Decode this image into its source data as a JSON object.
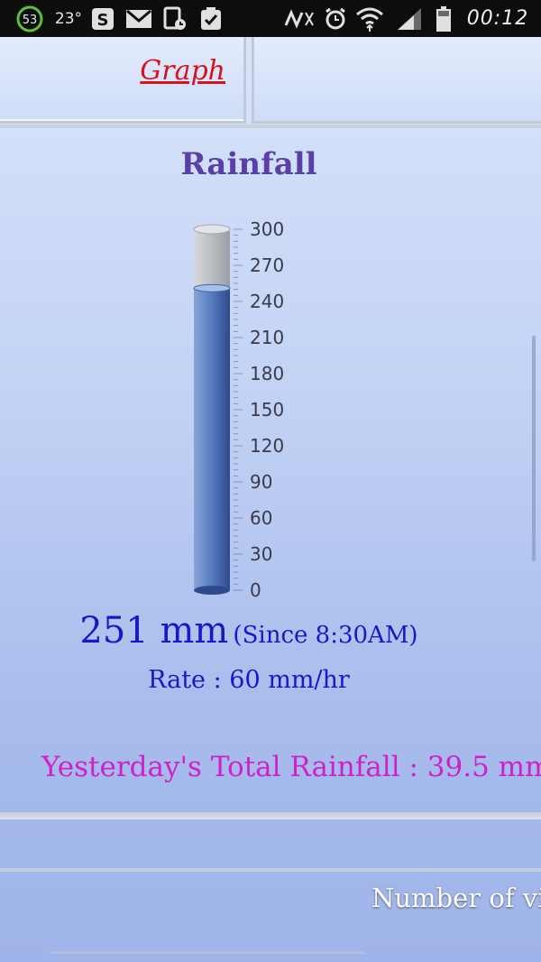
{
  "status_bar": {
    "notification_count": "53",
    "temperature": "23°",
    "time": "00:12",
    "icons": [
      "battery-saver-icon",
      "skype-icon",
      "gmail-icon",
      "calendar-icon",
      "task-icon",
      "nfc-icon",
      "alarm-icon",
      "wifi-icon",
      "signal-icon",
      "battery-icon"
    ]
  },
  "header": {
    "graph_link": "Graph"
  },
  "gauge": {
    "title": "Rainfall",
    "value": 251,
    "max": 300,
    "min": 0,
    "tick_labels": [
      "300",
      "270",
      "240",
      "210",
      "180",
      "150",
      "120",
      "90",
      "60",
      "30",
      "0"
    ],
    "fill_color": "#5a7fc2",
    "empty_color": "#b9bcc1"
  },
  "reading": {
    "value_text": "251 mm",
    "since_text": "(Since 8:30AM)",
    "rate_text": "Rate : 60 mm/hr"
  },
  "yesterday_text": "Yesterday's Total Rainfall : 39.5 mm",
  "visitors_text": "Number of vi",
  "colors": {
    "title": "#5a3fa8",
    "reading": "#1818c8",
    "yesterday": "#d020c8",
    "link": "#d4141c"
  }
}
